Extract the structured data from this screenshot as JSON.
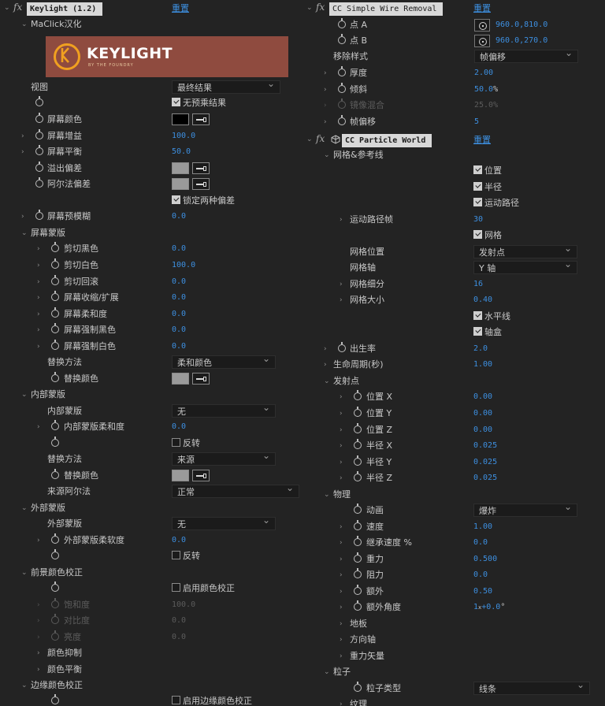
{
  "left": {
    "effect_name": "Keylight (1.2)",
    "reset": "重置",
    "about_group": "MaClick汉化",
    "logo": {
      "brand": "KEYLIGHT",
      "tagline": "BY THE FOUNDRY"
    },
    "view": {
      "label": "视图",
      "value": "最终结果"
    },
    "unpremultiply": {
      "label": "无预乘结果",
      "checked": true
    },
    "screen_colour": {
      "label": "屏幕颜色",
      "swatch": "#000000"
    },
    "screen_gain": {
      "label": "屏幕增益",
      "value": "100.0"
    },
    "screen_balance": {
      "label": "屏幕平衡",
      "value": "50.0"
    },
    "despill_bias": {
      "label": "溢出偏差",
      "swatch": "#9a9a9a"
    },
    "alpha_bias": {
      "label": "阿尔法偏差",
      "swatch": "#9a9a9a"
    },
    "lock_biases": {
      "label": "锁定两种偏差",
      "checked": true
    },
    "screen_preblur": {
      "label": "屏幕预模糊",
      "value": "0.0"
    },
    "screen_matte": {
      "label": "屏幕蒙版",
      "items": [
        {
          "label": "剪切黑色",
          "value": "0.0"
        },
        {
          "label": "剪切白色",
          "value": "100.0"
        },
        {
          "label": "剪切回滚",
          "value": "0.0"
        },
        {
          "label": "屏幕收缩/扩展",
          "value": "0.0"
        },
        {
          "label": "屏幕柔和度",
          "value": "0.0"
        },
        {
          "label": "屏幕强制黑色",
          "value": "0.0"
        },
        {
          "label": "屏幕强制白色",
          "value": "0.0"
        }
      ],
      "replace_method": {
        "label": "替换方法",
        "value": "柔和颜色"
      },
      "replace_colour": {
        "label": "替换颜色",
        "swatch": "#9a9a9a"
      }
    },
    "inside_mask": {
      "label": "内部蒙版",
      "mask": {
        "label": "内部蒙版",
        "value": "无"
      },
      "softness": {
        "label": "内部蒙版柔和度",
        "value": "0.0"
      },
      "invert": {
        "label": "反转",
        "checked": false
      },
      "replace_method": {
        "label": "替换方法",
        "value": "来源"
      },
      "replace_colour": {
        "label": "替换颜色",
        "swatch": "#9a9a9a"
      },
      "source_alpha": {
        "label": "来源阿尔法",
        "value": "正常"
      }
    },
    "outside_mask": {
      "label": "外部蒙版",
      "mask": {
        "label": "外部蒙版",
        "value": "无"
      },
      "softness": {
        "label": "外部蒙版柔软度",
        "value": "0.0"
      },
      "invert": {
        "label": "反转",
        "checked": false
      }
    },
    "fg_colour_correction": {
      "label": "前景颜色校正",
      "enable": {
        "label": "启用颜色校正",
        "checked": false
      },
      "saturation": {
        "label": "饱和度",
        "value": "100.0"
      },
      "contrast": {
        "label": "对比度",
        "value": "0.0"
      },
      "brightness": {
        "label": "亮度",
        "value": "0.0"
      },
      "colour_suppression": "颜色抑制",
      "colour_balancing": "颜色平衡"
    },
    "edge_colour_correction": {
      "label": "边缘颜色校正",
      "enable": {
        "label": "启用边缘颜色校正",
        "checked": false
      }
    }
  },
  "right": {
    "wire": {
      "effect_name": "CC Simple Wire Removal",
      "reset": "重置",
      "point_a": {
        "label": "点 A",
        "value": "960.0,810.0"
      },
      "point_b": {
        "label": "点 B",
        "value": "960.0,270.0"
      },
      "removal_style": {
        "label": "移除样式",
        "value": "帧偏移"
      },
      "thickness": {
        "label": "厚度",
        "value": "2.00"
      },
      "slope": {
        "label": "倾斜",
        "value": "50.0",
        "unit": "%"
      },
      "mirror_blend": {
        "label": "镜像混合",
        "value": "25.0",
        "unit": "%"
      },
      "frame_offset": {
        "label": "帧偏移",
        "value": "5"
      }
    },
    "particle": {
      "effect_name": "CC Particle World",
      "reset": "重置",
      "grid_guides": {
        "label": "网格&参考线",
        "position": {
          "label": "位置",
          "checked": true
        },
        "radius": {
          "label": "半径",
          "checked": true
        },
        "motion_path": {
          "label": "运动路径",
          "checked": true
        },
        "motion_path_frames": {
          "label": "运动路径帧",
          "value": "30"
        },
        "grid": {
          "label": "网格",
          "checked": true
        },
        "grid_position": {
          "label": "网格位置",
          "value": "发射点"
        },
        "grid_axis": {
          "label": "网格轴",
          "value": "Y 轴"
        },
        "grid_subdivision": {
          "label": "网格细分",
          "value": "16"
        },
        "grid_size": {
          "label": "网格大小",
          "value": "0.40"
        },
        "horizon": {
          "label": "水平线",
          "checked": true
        },
        "axis_box": {
          "label": "轴盒",
          "checked": true
        }
      },
      "birth_rate": {
        "label": "出生率",
        "value": "2.0"
      },
      "longevity": {
        "label": "生命周期(秒)",
        "value": "1.00"
      },
      "producer": {
        "label": "发射点",
        "items": [
          {
            "label": "位置 X",
            "value": "0.00"
          },
          {
            "label": "位置 Y",
            "value": "0.00"
          },
          {
            "label": "位置 Z",
            "value": "0.00"
          },
          {
            "label": "半径 X",
            "value": "0.025"
          },
          {
            "label": "半径 Y",
            "value": "0.025"
          },
          {
            "label": "半径 Z",
            "value": "0.025"
          }
        ]
      },
      "physics": {
        "label": "物理",
        "animation": {
          "label": "动画",
          "value": "爆炸"
        },
        "velocity": {
          "label": "速度",
          "value": "1.00"
        },
        "inherit_velocity": {
          "label": "继承速度 %",
          "value": "0.0"
        },
        "gravity": {
          "label": "重力",
          "value": "0.500"
        },
        "resistance": {
          "label": "阻力",
          "value": "0.0"
        },
        "extra": {
          "label": "额外",
          "value": "0.50"
        },
        "extra_angle": {
          "label": "额外角度",
          "value": "1",
          "sub": "x",
          "rest": "+0.0",
          "unit": "°"
        },
        "floor": "地板",
        "direction_axis": "方向轴",
        "gravity_vector": "重力矢量"
      },
      "particle_section": {
        "label": "粒子",
        "particle_type": {
          "label": "粒子类型",
          "value": "线条"
        },
        "texture": "纹理"
      }
    }
  }
}
